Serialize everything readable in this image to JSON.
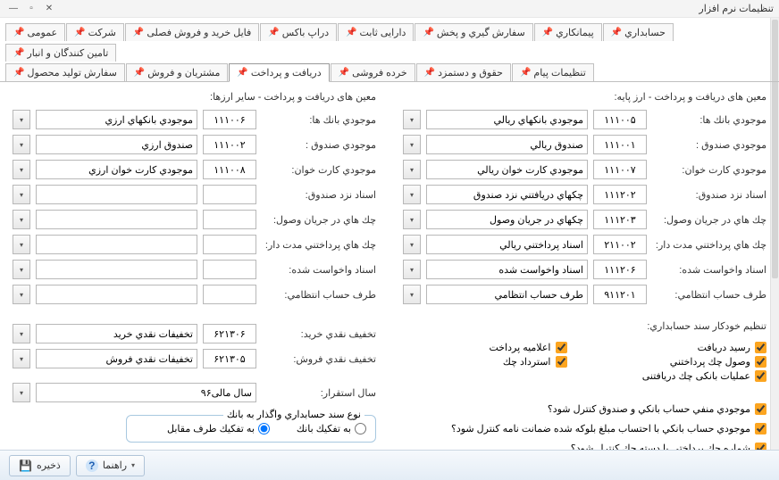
{
  "window": {
    "title": "تنظیمات نرم افزار"
  },
  "tabs_row1": [
    "حسابداري",
    "پیمانکاري",
    "سفارش گیري و پخش",
    "دارایی ثابت",
    "دراپ باکس",
    "فایل خرید و فروش فصلی",
    "شرکت",
    "عمومی",
    "تامین کنندگان و انبار"
  ],
  "tabs_row2": [
    "تنظیمات پیام",
    "حقوق و دستمزد",
    "خرده فروشی",
    "دریافت و پرداخت",
    "مشتریان و فروش",
    "سفارش تولید محصول"
  ],
  "active_tab": "دریافت و پرداخت",
  "right": {
    "title": "معین های دریافت و پرداخت - ارز پایه:",
    "rows": [
      {
        "lbl": "موجودي بانك ها:",
        "code": "۱۱۱۰۰۵",
        "desc": "موجودي بانکهاي ريالي"
      },
      {
        "lbl": "موجودي صندوق :",
        "code": "۱۱۱۰۰۱",
        "desc": "صندوق ريالي"
      },
      {
        "lbl": "موجودي كارت خوان:",
        "code": "۱۱۱۰۰۷",
        "desc": "موجودي کارت خوان ريالي"
      },
      {
        "lbl": "اسناد نزد صندوق:",
        "code": "۱۱۱۲۰۲",
        "desc": "چکهاي دريافتني نزد صندوق"
      },
      {
        "lbl": "چك هاي در جريان وصول:",
        "code": "۱۱۱۲۰۳",
        "desc": "چکهاي در جريان وصول"
      },
      {
        "lbl": "چك هاي پرداختني مدت دار:",
        "code": "۲۱۱۰۰۲",
        "desc": "اسناد پرداختني ريالي"
      },
      {
        "lbl": "اسناد واخواست شده:",
        "code": "۱۱۱۲۰۶",
        "desc": "اسناد واخواست شده"
      },
      {
        "lbl": "طرف حساب انتظامي:",
        "code": "۹۱۱۲۰۱",
        "desc": "طرف حساب انتظامي"
      }
    ]
  },
  "left": {
    "title": "معین های دریافت و پرداخت - سایر ارزها:",
    "rows": [
      {
        "lbl": "موجودي بانك ها:",
        "code": "۱۱۱۰۰۶",
        "desc": "موجودي بانکهاي ارزي"
      },
      {
        "lbl": "موجودي صندوق :",
        "code": "۱۱۱۰۰۲",
        "desc": "صندوق ارزي"
      },
      {
        "lbl": "موجودي كارت خوان:",
        "code": "۱۱۱۰۰۸",
        "desc": "موجودي کارت خوان ارزي"
      },
      {
        "lbl": "اسناد نزد صندوق:",
        "code": "",
        "desc": ""
      },
      {
        "lbl": "چك هاي در جريان وصول:",
        "code": "",
        "desc": ""
      },
      {
        "lbl": "چك هاي پرداختني مدت دار:",
        "code": "",
        "desc": ""
      },
      {
        "lbl": "اسناد واخواست شده:",
        "code": "",
        "desc": ""
      },
      {
        "lbl": "طرف حساب انتظامي:",
        "code": "",
        "desc": ""
      }
    ]
  },
  "auto_doc": {
    "title": "تنظیم خودکار سند حسابداري:",
    "checks": [
      {
        "label": "رسید دریافت",
        "checked": true
      },
      {
        "label": "وصول چك پرداختني",
        "checked": true
      },
      {
        "label": "عملیات بانکی چك دریافتنی",
        "checked": true
      },
      {
        "label": "اعلامیه پرداخت",
        "checked": true
      },
      {
        "label": "استرداد چك",
        "checked": true
      }
    ]
  },
  "extra_checks": [
    {
      "label": "موجودي منفي حساب بانكي و صندوق كنترل شود؟",
      "checked": true
    },
    {
      "label": "موجودي حساب بانكي با احتساب مبلغ بلوكه شده ضمانت نامه كنترل شود؟",
      "checked": true
    },
    {
      "label": "شماره چك پرداختي با دسته چك كنترل شود؟",
      "checked": true
    }
  ],
  "discount": {
    "rows": [
      {
        "lbl": "تخفيف نقدي خريد:",
        "code": "۶۲۱۳۰۶",
        "desc": "تخفيفات نقدي خريد"
      },
      {
        "lbl": "تخفيف نقدي فروش:",
        "code": "۶۲۱۳۰۵",
        "desc": "تخفيفات نقدي فروش"
      }
    ]
  },
  "year": {
    "lbl": "سال استقرار:",
    "value": "سال مالی۹۶"
  },
  "radiogroup": {
    "title": "نوع سند حسابداري واگذار به بانك",
    "opts": [
      {
        "label": "به تفكيك بانك",
        "val": "bank"
      },
      {
        "label": "به تفكيك طرف مقابل",
        "val": "counter"
      }
    ],
    "selected": "counter"
  },
  "footer": {
    "save": "ذخیره",
    "help": "راهنما"
  }
}
